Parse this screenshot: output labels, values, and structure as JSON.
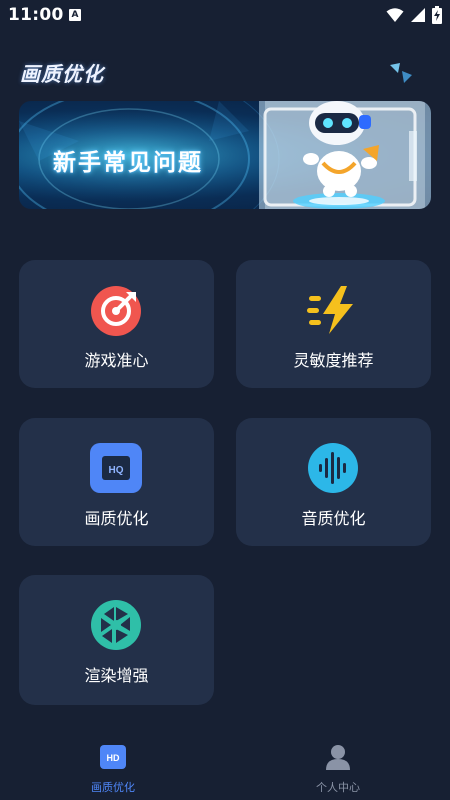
{
  "status_bar": {
    "time": "11:00",
    "notification_letter": "A",
    "icons": [
      "wifi-icon",
      "signal-icon",
      "battery-charging-icon"
    ]
  },
  "header": {
    "title": "画质优化"
  },
  "banner": {
    "text": "新手常见问题"
  },
  "tiles": [
    {
      "label": "游戏准心",
      "icon": "crosshair-target-icon",
      "color": "#f0564f"
    },
    {
      "label": "灵敏度推荐",
      "icon": "lightning-icon",
      "color": "#f5c01d"
    },
    {
      "label": "画质优化",
      "icon": "hq-icon",
      "color": "#4f86f7"
    },
    {
      "label": "音质优化",
      "icon": "soundwave-icon",
      "color": "#2cb7e8"
    },
    {
      "label": "渲染增强",
      "icon": "aperture-icon",
      "color": "#2fbfa8"
    }
  ],
  "bottom_nav": [
    {
      "label": "画质优化",
      "icon": "hd-icon",
      "active": true,
      "color": "#4f86f7"
    },
    {
      "label": "个人中心",
      "icon": "person-icon",
      "active": false,
      "color": "#8a93a6"
    }
  ]
}
